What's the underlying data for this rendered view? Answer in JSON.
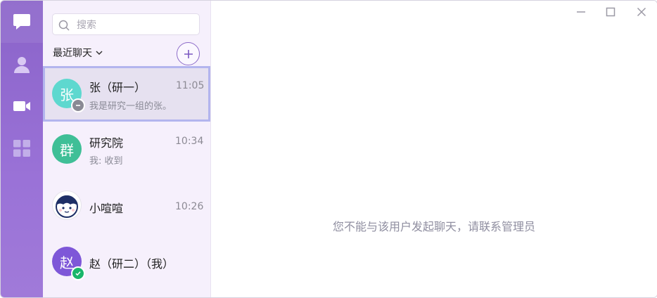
{
  "search": {
    "placeholder": "搜索"
  },
  "list_header": {
    "label": "最近聊天"
  },
  "conversations": [
    {
      "avatar_text": "张",
      "avatar_color": "#5ed8cf",
      "name": "张（研一）",
      "time": "11:05",
      "preview": "我是研究一组的张。",
      "status": "busy-icon",
      "active": true
    },
    {
      "avatar_text": "群",
      "avatar_color": "#3fbf97",
      "name": "研究院",
      "time": "10:34",
      "preview": "我: 收到"
    },
    {
      "avatar_text": "",
      "avatar_icon": "cartoon-face-icon",
      "name": "小喧喧",
      "time": "10:26"
    },
    {
      "avatar_text": "赵",
      "avatar_color": "#7e57d8",
      "name": "赵（研二）（我）",
      "status": "online-check-icon"
    }
  ],
  "main": {
    "notice": "您不能与该用户发起聊天，请联系管理员"
  },
  "colors": {
    "rail": "#8a63c9",
    "accent": "#8c6bc8",
    "active_border": "#b3b5ee"
  }
}
